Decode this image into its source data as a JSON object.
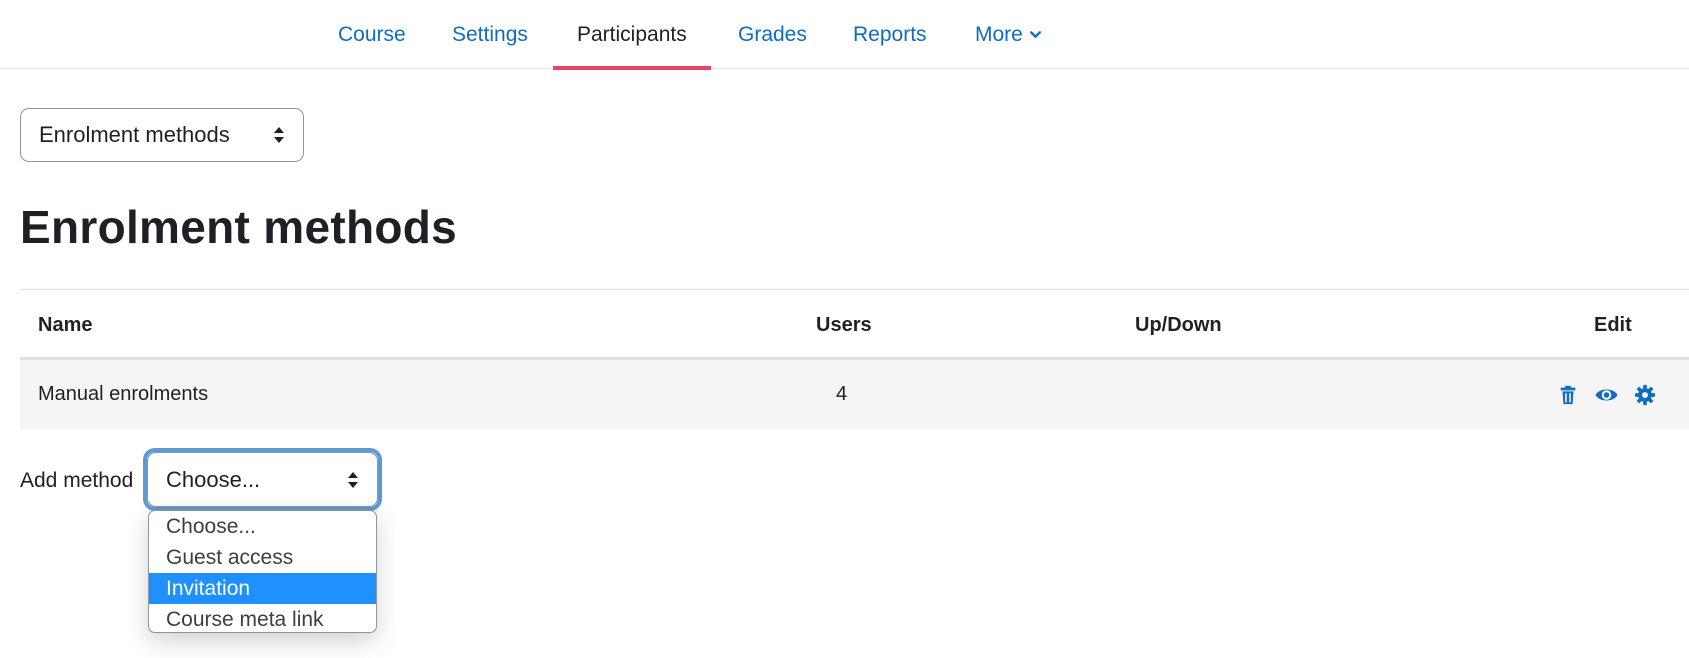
{
  "nav": {
    "items": [
      {
        "label": "Course"
      },
      {
        "label": "Settings"
      },
      {
        "label": "Participants",
        "active": true
      },
      {
        "label": "Grades"
      },
      {
        "label": "Reports"
      },
      {
        "label": "More"
      }
    ]
  },
  "tertiary_select": {
    "value": "Enrolment methods"
  },
  "page": {
    "title": "Enrolment methods"
  },
  "table": {
    "headers": {
      "name": "Name",
      "users": "Users",
      "updown": "Up/Down",
      "edit": "Edit"
    },
    "rows": [
      {
        "name": "Manual enrolments",
        "users": "4",
        "actions": [
          "trash-icon",
          "eye-icon",
          "gear-icon"
        ]
      }
    ]
  },
  "add_method": {
    "label": "Add method",
    "value": "Choose...",
    "options": [
      "Choose...",
      "Guest access",
      "Invitation",
      "Course meta link"
    ],
    "highlighted": "Invitation"
  },
  "colors": {
    "link": "#0f6cbf",
    "active_tab_underline": "#e8456b",
    "highlight": "#1e90ff",
    "row_bg": "#f5f5f5",
    "focus_ring": "#5b9ad3"
  }
}
